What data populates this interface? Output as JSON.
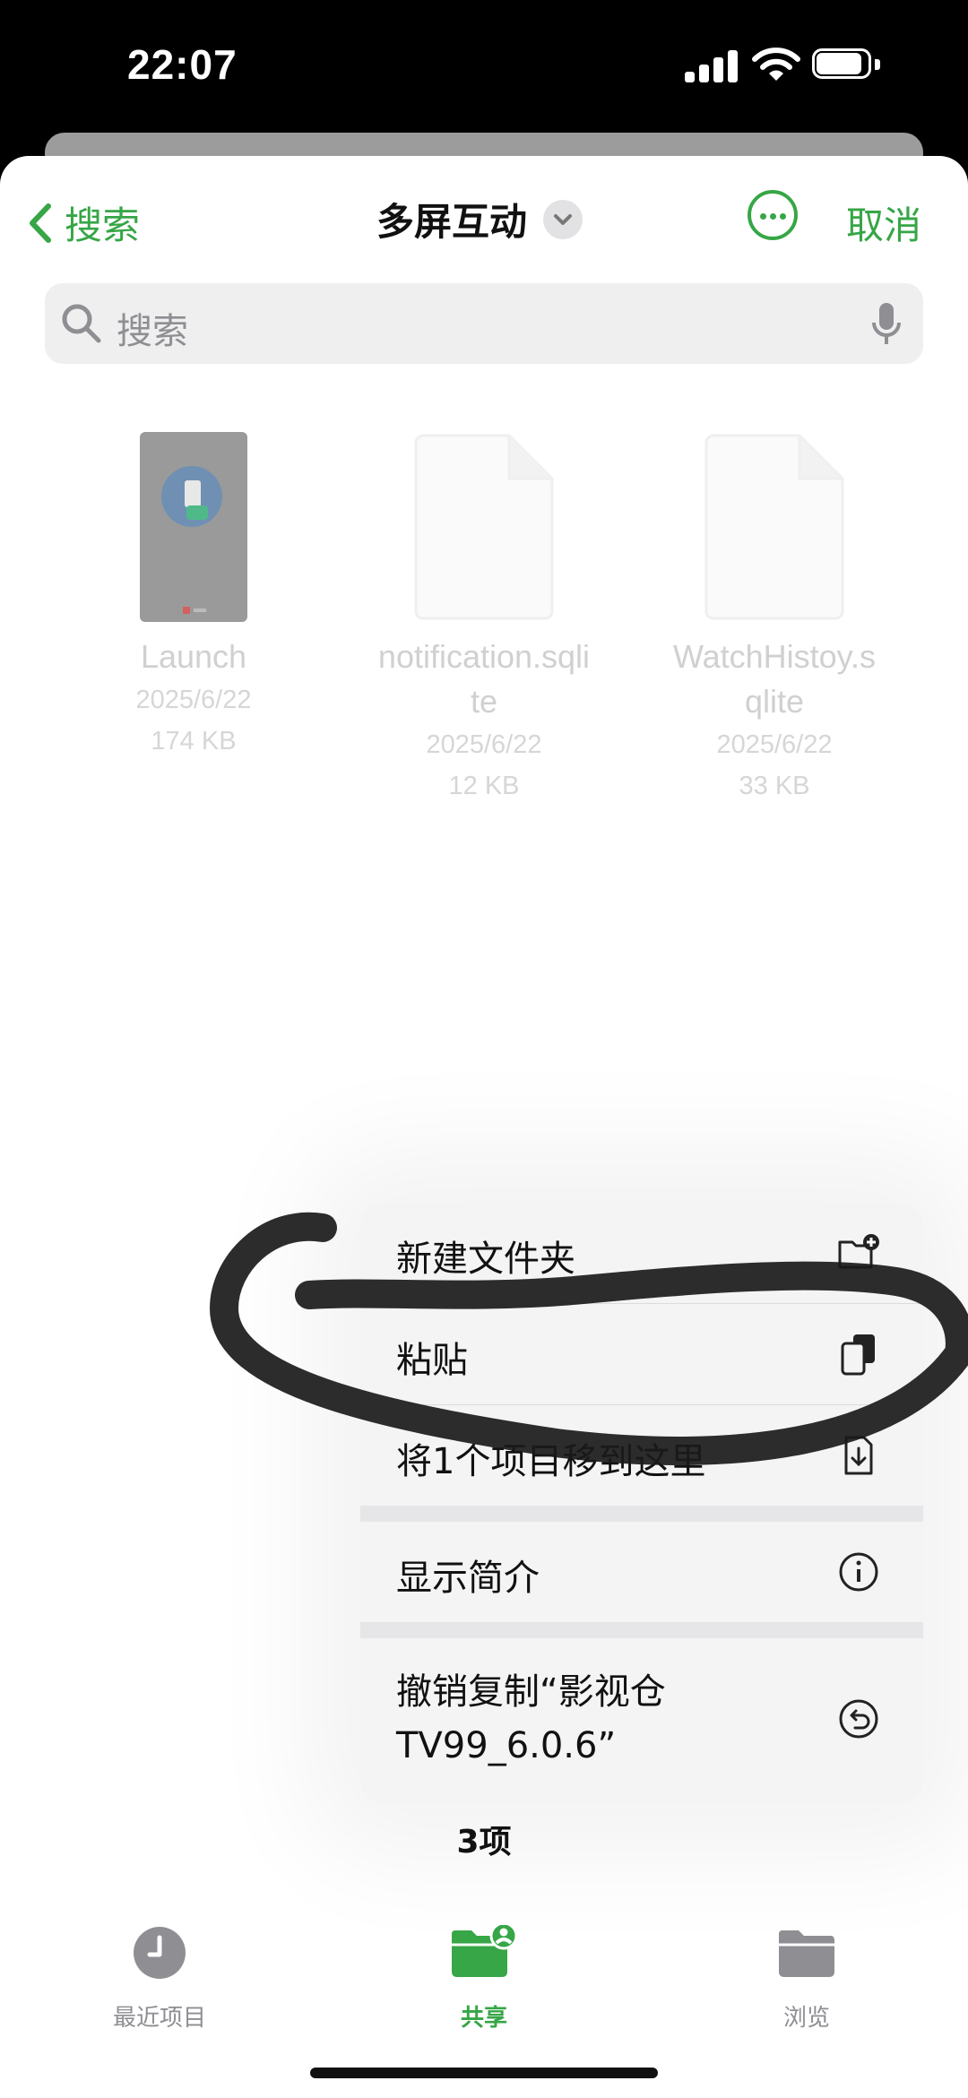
{
  "status_bar": {
    "time": "22:07"
  },
  "nav": {
    "back_label": "搜索",
    "title": "多屏互动",
    "cancel_label": "取消"
  },
  "search": {
    "placeholder": "搜索"
  },
  "files": [
    {
      "name": "Launch",
      "date": "2025/6/22",
      "size": "174 KB"
    },
    {
      "name": "notification.sqli\nte",
      "date": "2025/6/22",
      "size": "12 KB"
    },
    {
      "name": "WatchHistoy.s\nqlite",
      "date": "2025/6/22",
      "size": "33 KB"
    }
  ],
  "menu": {
    "items": [
      {
        "label": "新建文件夹",
        "icon": "folder-plus-icon"
      },
      {
        "label": "粘贴",
        "icon": "paste-icon"
      },
      {
        "label": "将1个项目移到这里",
        "icon": "move-here-icon"
      },
      {
        "label": "显示简介",
        "icon": "info-icon"
      },
      {
        "label": "撤销复制“影视仓\nTV99_6.0.6”",
        "icon": "undo-icon"
      }
    ]
  },
  "item_count": "3项",
  "tabs": [
    {
      "label": "最近项目",
      "icon": "clock-icon",
      "active": false
    },
    {
      "label": "共享",
      "icon": "shared-folder-icon",
      "active": true
    },
    {
      "label": "浏览",
      "icon": "folder-icon",
      "active": false
    }
  ],
  "colors": {
    "accent": "#36a646",
    "background": "#ffffff",
    "menu_bg": "#f4f4f5"
  }
}
